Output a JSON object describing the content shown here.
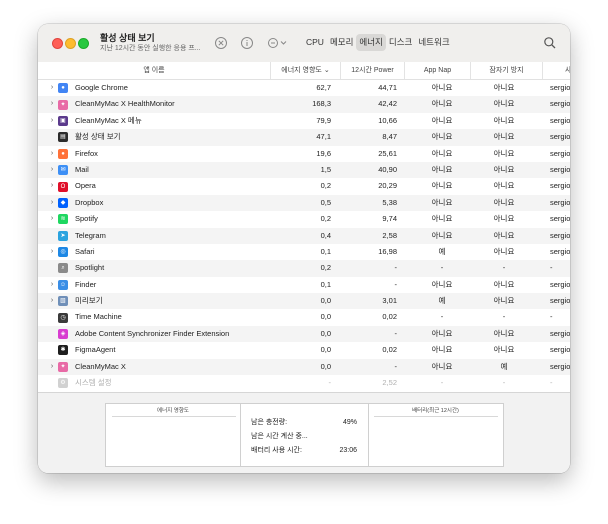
{
  "window": {
    "title": "활성 상태 보기",
    "subtitle": "지난 12시간 동안 실행한 응용 프...",
    "toolbar_icons": [
      "close-circle-icon",
      "info-icon",
      "more-options-icon",
      "search-icon"
    ],
    "tabs": [
      {
        "label": "CPU",
        "active": false
      },
      {
        "label": "메모리",
        "active": false
      },
      {
        "label": "에너지",
        "active": true
      },
      {
        "label": "디스크",
        "active": false
      },
      {
        "label": "네트워크",
        "active": false
      }
    ]
  },
  "table": {
    "columns": [
      "앱 이름",
      "에너지 영향도",
      "12시간 Power",
      "App Nap",
      "잠자기 방지",
      "사"
    ],
    "sort_indicator": "⌄",
    "rows": [
      {
        "expand": true,
        "icon": "chrome-icon",
        "icon_color": "#4285f4",
        "name": "Google Chrome",
        "energy": "62,7",
        "power12h": "44,71",
        "appnap": "아니요",
        "sleep": "아니요",
        "user": "sergio"
      },
      {
        "expand": true,
        "icon": "cleanmymac-icon",
        "icon_color": "#e86aa6",
        "name": "CleanMyMac X HealthMonitor",
        "energy": "168,3",
        "power12h": "42,42",
        "appnap": "아니요",
        "sleep": "아니요",
        "user": "sergio"
      },
      {
        "expand": true,
        "icon": "cleanmymac-menu-icon",
        "icon_color": "#5b3a8c",
        "name": "CleanMyMac X 메뉴",
        "energy": "79,9",
        "power12h": "10,66",
        "appnap": "아니요",
        "sleep": "아니요",
        "user": "sergio"
      },
      {
        "expand": false,
        "icon": "activity-monitor-icon",
        "icon_color": "#2b2b2b",
        "name": "활성 상태 보기",
        "energy": "47,1",
        "power12h": "8,47",
        "appnap": "아니요",
        "sleep": "아니요",
        "user": "sergio"
      },
      {
        "expand": true,
        "icon": "firefox-icon",
        "icon_color": "#ff7139",
        "name": "Firefox",
        "energy": "19,6",
        "power12h": "25,61",
        "appnap": "아니요",
        "sleep": "아니요",
        "user": "sergio"
      },
      {
        "expand": true,
        "icon": "mail-icon",
        "icon_color": "#3d8ff5",
        "name": "Mail",
        "energy": "1,5",
        "power12h": "40,90",
        "appnap": "아니요",
        "sleep": "아니요",
        "user": "sergio"
      },
      {
        "expand": true,
        "icon": "opera-icon",
        "icon_color": "#e0102a",
        "name": "Opera",
        "energy": "0,2",
        "power12h": "20,29",
        "appnap": "아니요",
        "sleep": "아니요",
        "user": "sergio"
      },
      {
        "expand": true,
        "icon": "dropbox-icon",
        "icon_color": "#0061fe",
        "name": "Dropbox",
        "energy": "0,5",
        "power12h": "5,38",
        "appnap": "아니요",
        "sleep": "아니요",
        "user": "sergio"
      },
      {
        "expand": true,
        "icon": "spotify-icon",
        "icon_color": "#1ed760",
        "name": "Spotify",
        "energy": "0,2",
        "power12h": "9,74",
        "appnap": "아니요",
        "sleep": "아니요",
        "user": "sergio"
      },
      {
        "expand": false,
        "icon": "telegram-icon",
        "icon_color": "#2aa3df",
        "name": "Telegram",
        "energy": "0,4",
        "power12h": "2,58",
        "appnap": "아니요",
        "sleep": "아니요",
        "user": "sergio"
      },
      {
        "expand": true,
        "icon": "safari-icon",
        "icon_color": "#1e88e5",
        "name": "Safari",
        "energy": "0,1",
        "power12h": "16,98",
        "appnap": "예",
        "sleep": "아니요",
        "user": "sergio"
      },
      {
        "expand": false,
        "icon": "spotlight-icon",
        "icon_color": "#8a8a8a",
        "name": "Spotlight",
        "energy": "0,2",
        "power12h": "-",
        "appnap": "-",
        "sleep": "-",
        "user": "-"
      },
      {
        "expand": true,
        "icon": "finder-icon",
        "icon_color": "#3a8ee6",
        "name": "Finder",
        "energy": "0,1",
        "power12h": "-",
        "appnap": "아니요",
        "sleep": "아니요",
        "user": "sergio"
      },
      {
        "expand": true,
        "icon": "preview-icon",
        "icon_color": "#6f8fb8",
        "name": "미리보기",
        "energy": "0,0",
        "power12h": "3,01",
        "appnap": "예",
        "sleep": "아니요",
        "user": "sergio"
      },
      {
        "expand": false,
        "icon": "time-machine-icon",
        "icon_color": "#3a3a3a",
        "name": "Time Machine",
        "energy": "0,0",
        "power12h": "0,02",
        "appnap": "-",
        "sleep": "-",
        "user": "-"
      },
      {
        "expand": false,
        "icon": "adobe-icon",
        "icon_color": "#d83dd0",
        "name": "Adobe Content Synchronizer Finder Extension",
        "energy": "0,0",
        "power12h": "-",
        "appnap": "아니요",
        "sleep": "아니요",
        "user": "sergio"
      },
      {
        "expand": false,
        "icon": "figma-icon",
        "icon_color": "#1e1e1e",
        "name": "FigmaAgent",
        "energy": "0,0",
        "power12h": "0,02",
        "appnap": "아니요",
        "sleep": "아니요",
        "user": "sergio"
      },
      {
        "expand": true,
        "icon": "cleanmymac-icon",
        "icon_color": "#e86aa6",
        "name": "CleanMyMac X",
        "energy": "0,0",
        "power12h": "-",
        "appnap": "아니요",
        "sleep": "예",
        "user": "sergio"
      },
      {
        "expand": false,
        "icon": "system-settings-icon",
        "icon_color": "#9a9a9a",
        "name": "시스템 설정",
        "energy": "-",
        "power12h": "2,52",
        "appnap": "-",
        "sleep": "-",
        "user": "-",
        "dim": true
      }
    ]
  },
  "bottom": {
    "energy_chart_title": "에너지 영향도",
    "battery_chart_title": "배터리(최근 12시간)",
    "stats": [
      {
        "label": "남은 충전량:",
        "value": "49%"
      },
      {
        "label": "남은 시간 계산 중...",
        "value": ""
      },
      {
        "label": "배터리 사용 시간:",
        "value": "23:06"
      }
    ]
  }
}
